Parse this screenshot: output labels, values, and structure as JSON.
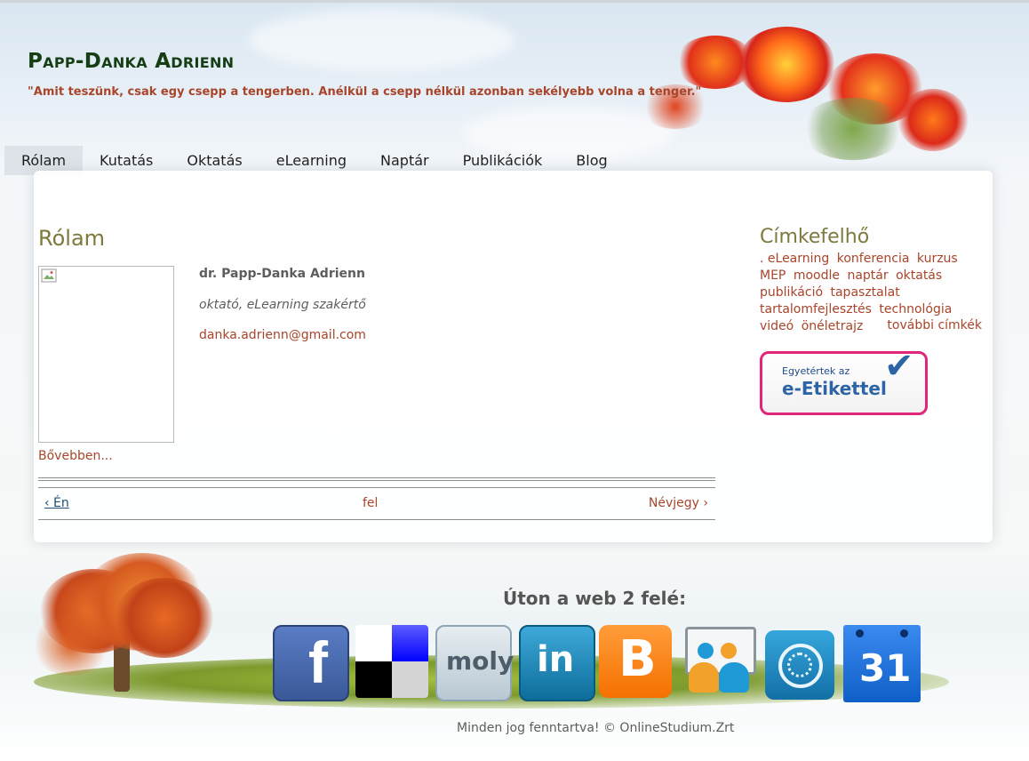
{
  "header": {
    "site_title": "Papp-Danka Adrienn",
    "slogan": "\"Amit teszünk, csak egy csepp a tengerben. Anélkül a csepp nélkül azonban sekélyebb volna a tenger.\""
  },
  "nav": {
    "items": [
      {
        "label": "Rólam",
        "active": true
      },
      {
        "label": "Kutatás"
      },
      {
        "label": "Oktatás"
      },
      {
        "label": "eLearning"
      },
      {
        "label": "Naptár"
      },
      {
        "label": "Publikációk"
      },
      {
        "label": "Blog"
      }
    ]
  },
  "main": {
    "title": "Rólam",
    "name": "dr. Papp-Danka Adrienn",
    "role": "oktató, eLearning szakértő",
    "email": "danka.adrienn@gmail.com",
    "more": "Bővebben...",
    "pager": {
      "prev": "‹ Én",
      "up": "fel",
      "next": "Névjegy ›"
    }
  },
  "sidebar": {
    "title": "Címkefelhő",
    "tags": [
      ". eLearning",
      "konferencia",
      "kurzus",
      "MEP",
      "moodle",
      "naptár",
      "oktatás",
      "publikáció",
      "tapasztalat",
      "tartalomfejlesztés",
      "technológia",
      "videó",
      "önéletrajz"
    ],
    "more_tags": "további címkék",
    "badge_small": "Egyetértek az",
    "badge_big": "e-Etikettel"
  },
  "footer": {
    "web_title": "Úton a web 2 felé:",
    "icons": [
      {
        "name": "facebook-icon",
        "color": "#3b5998",
        "glyph": "f"
      },
      {
        "name": "delicious-icon",
        "color": "#0000ff",
        "glyph": ""
      },
      {
        "name": "moly-icon",
        "color": "#c9d6de",
        "glyph": "moly"
      },
      {
        "name": "linkedin-icon",
        "color": "#1e88b6",
        "glyph": "in"
      },
      {
        "name": "blogger-icon",
        "color": "#f57d00",
        "glyph": "B"
      },
      {
        "name": "slideshare-icon",
        "color": "#d9e2e6",
        "glyph": ""
      },
      {
        "name": "prezi-icon",
        "color": "#1f8bc4",
        "glyph": ""
      },
      {
        "name": "google-calendar-icon",
        "color": "#1b6fd6",
        "glyph": "31"
      }
    ],
    "copyright": "Minden jog fenntartva! © OnlineStudium.Zrt"
  }
}
